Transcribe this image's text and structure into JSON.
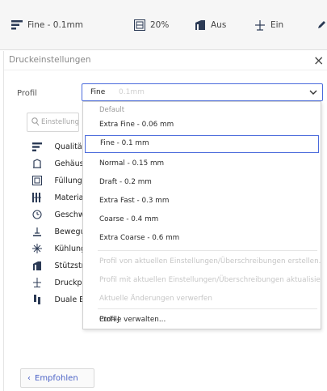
{
  "topbar": {
    "profile": "Fine - 0.1mm",
    "infill": "20%",
    "support": "Aus",
    "adhesion": "Ein"
  },
  "panel": {
    "title": "Druckeinstellungen",
    "close": "×",
    "profile_label": "Profil",
    "search_placeholder": "Einstellungen durchsuchen",
    "categories": [
      {
        "label": "Qualität",
        "icon": "quality-icon"
      },
      {
        "label": "Gehäuse",
        "icon": "shell-icon"
      },
      {
        "label": "Füllung",
        "icon": "infill-icon"
      },
      {
        "label": "Material",
        "icon": "material-icon"
      },
      {
        "label": "Geschwindigkeit",
        "icon": "speed-icon"
      },
      {
        "label": "Bewegungen",
        "icon": "travel-icon"
      },
      {
        "label": "Kühlung",
        "icon": "cooling-icon"
      },
      {
        "label": "Stützstruktur",
        "icon": "support-icon"
      },
      {
        "label": "Druckplattenhaftung",
        "icon": "adhesion-icon"
      },
      {
        "label": "Duale Extrusion",
        "icon": "dual-extrusion-icon"
      }
    ],
    "recommended_label": "Empfohlen"
  },
  "profile_select": {
    "value": "Fine",
    "value_suffix": "0.1mm"
  },
  "menu": {
    "section": "Default",
    "items": [
      {
        "label": "Extra Fine - 0.06 mm",
        "selected": false
      },
      {
        "label": "Fine - 0.1 mm",
        "selected": true
      },
      {
        "label": "Normal - 0.15 mm",
        "selected": false
      },
      {
        "label": "Draft - 0.2 mm",
        "selected": false
      },
      {
        "label": "Extra Fast - 0.3 mm",
        "selected": false
      },
      {
        "label": "Coarse - 0.4 mm",
        "selected": false
      },
      {
        "label": "Extra Coarse - 0.6 mm",
        "selected": false
      }
    ],
    "disabled_items": [
      "Profil von aktuellen Einstellungen/Überschreibungen erstellen...",
      "Profil mit aktuellen Einstellungen/Überschreibungen aktualisieren",
      "Aktuelle Änderungen verwerfen"
    ],
    "manage": "Profile verwalten...",
    "manage_shortcut": "Ctrl+J"
  },
  "colors": {
    "accent": "#4b6bdc",
    "link": "#4b62c6",
    "topbar_bg": "#f6f6f6"
  }
}
